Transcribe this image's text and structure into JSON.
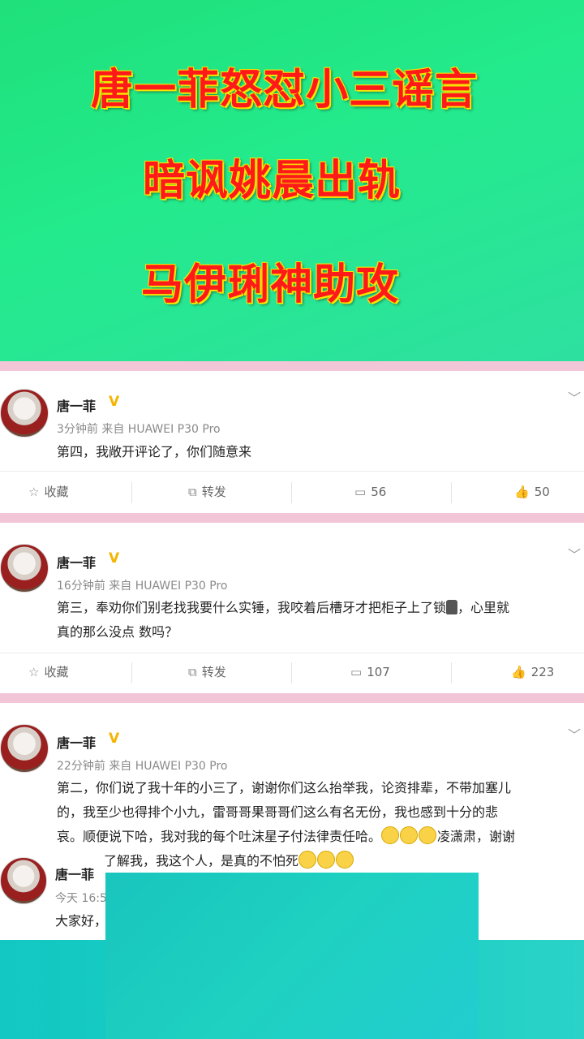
{
  "banner": {
    "line1": "唐一菲怒怼小三谣言",
    "line2": "暗讽姚晨出轨",
    "line3": "马伊琍神助攻"
  },
  "posts": [
    {
      "user": "唐一菲",
      "badge": "V",
      "meta": "3分钟前 来自 HUAWEI P30 Pro",
      "text": "第四，我敞开评论了，你们随意来",
      "favorite": "收藏",
      "repost": "转发",
      "comments": "56",
      "likes": "50"
    },
    {
      "user": "唐一菲",
      "badge": "V",
      "meta": "16分钟前 来自 HUAWEI P30 Pro",
      "text_a": "第三，奉劝你们别老找我要什么实锤，我咬着后槽牙才把柜子上了锁",
      "text_b": "，心里就",
      "text_c": "真的那么没点   数吗？",
      "favorite": "收藏",
      "repost": "转发",
      "comments": "107",
      "likes": "223"
    },
    {
      "user": "唐一菲",
      "badge": "V",
      "meta": "22分钟前 来自 HUAWEI P30 Pro",
      "text_a": "第二，你们说了我十年的小三了，谢谢你们这么抬举我，论资排辈，不带加塞儿",
      "text_b": "的，我至少也得排个小九，雷哥哥果哥哥们这么有名无份，我也感到十分的悲",
      "text_c": "哀。顺便说下哈，我对我的每个吐沫星子付法律责任哈。",
      "text_d": "凌潇肃，谢谢",
      "text_e": "了解我，我这个人，是真的不怕死"
    },
    {
      "user": "唐一菲",
      "meta": "今天 16:5",
      "text": "大家好，"
    }
  ],
  "colors": {
    "banner_green": "#23ea8c",
    "headline_red": "#ff1a1a",
    "headline_outline": "#f5e600",
    "separator_pink": "#f2c6d6",
    "verified_gold": "#f4b400",
    "overlay_teal": "#1ed1c0"
  },
  "icons": {
    "favorite": "star-outline-icon",
    "repost": "share-box-icon",
    "comment": "speech-bubble-icon",
    "like": "thumbs-up-icon",
    "more": "chevron-down-icon"
  }
}
